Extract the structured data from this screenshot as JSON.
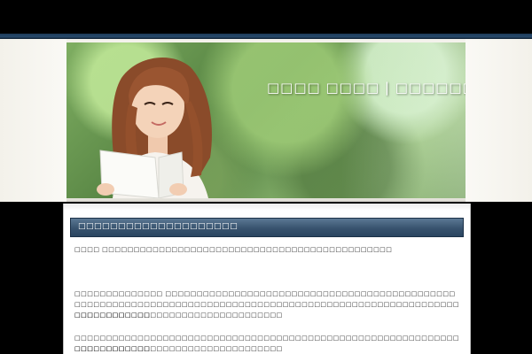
{
  "header": {
    "site_title": "□□□□ □□□□ | □□□□□□□□□□□"
  },
  "content": {
    "section_title": "□□□□□□□□□□□□□□□□□□□□",
    "paragraphs": [
      "□□□□ □□□□□□□□□□□□□□□□□□□□□□□□□□□□□□□□□□□□□□□□□□□□□□",
      "□□□□□□□□□□□□□□ □□□□□□□□□□□□□□□□□□□□□□□□□□□□□□□□□□□□□□□□□□□□□□□□□□□□□□□□□□□□□□□□□□□□□□□□□□□□□□□□□□□□□□□□□□□□□□□□□□□□□□□□□□□□□□□□□□□□□□□",
      "□□□□□□□□□□□□□□□□□□□□□□□□□□□□□□□□□",
      "□□□□□□□□□□□□□□□□□□□□□□□□□□□□□□□□□□□□□□□□□□□□□□□□□□□□□□□□□□□□□□□□□□□□□□□□□",
      "□□□□□□□□□□□□□□□□□□□□□□□□□□□□□□□□□"
    ]
  },
  "colors": {
    "accent": "#2a4561",
    "page_bg": "#000000",
    "header_bg": "#f4f2ec"
  }
}
